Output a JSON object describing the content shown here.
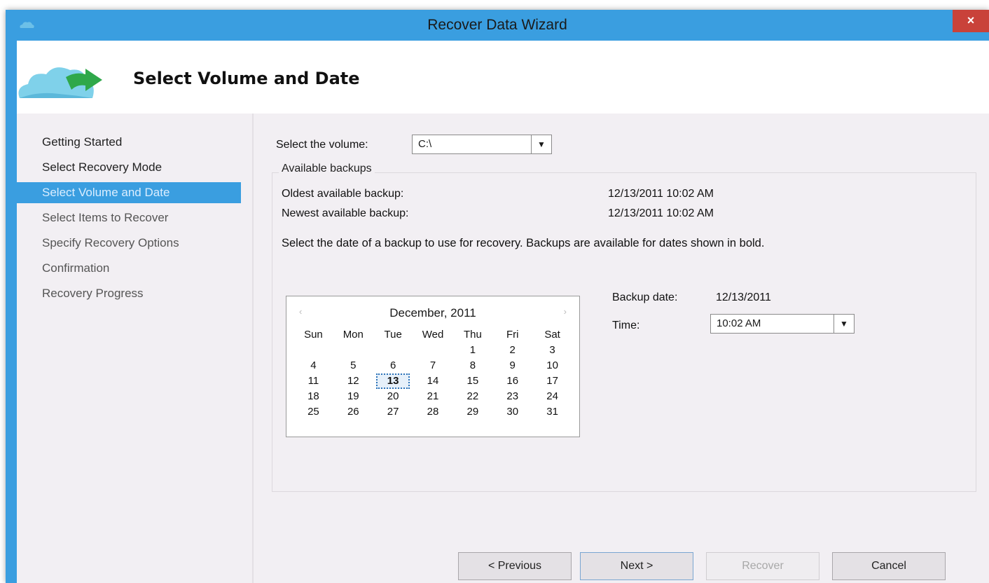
{
  "window": {
    "title": "Recover Data Wizard",
    "close_label": "×"
  },
  "header": {
    "title": "Select Volume and Date"
  },
  "nav": {
    "items": [
      {
        "label": "Getting Started"
      },
      {
        "label": "Select Recovery Mode"
      },
      {
        "label": "Select Volume and Date"
      },
      {
        "label": "Select Items to Recover"
      },
      {
        "label": "Specify Recovery Options"
      },
      {
        "label": "Confirmation"
      },
      {
        "label": "Recovery Progress"
      }
    ]
  },
  "volume": {
    "label": "Select the volume:",
    "value": "C:\\"
  },
  "backups": {
    "legend": "Available backups",
    "oldest_label": "Oldest available backup:",
    "oldest_value": "12/13/2011 10:02 AM",
    "newest_label": "Newest available backup:",
    "newest_value": "12/13/2011 10:02 AM",
    "instruction": "Select the date of a backup to use for recovery. Backups are available for dates shown in bold."
  },
  "calendar": {
    "month": "December, 2011",
    "prev": "‹",
    "next": "›",
    "days": [
      "Sun",
      "Mon",
      "Tue",
      "Wed",
      "Thu",
      "Fri",
      "Sat"
    ],
    "weeks": [
      [
        "",
        "",
        "",
        "",
        "1",
        "2",
        "3"
      ],
      [
        "4",
        "5",
        "6",
        "7",
        "8",
        "9",
        "10"
      ],
      [
        "11",
        "12",
        "13",
        "14",
        "15",
        "16",
        "17"
      ],
      [
        "18",
        "19",
        "20",
        "21",
        "22",
        "23",
        "24"
      ],
      [
        "25",
        "26",
        "27",
        "28",
        "29",
        "30",
        "31"
      ]
    ],
    "selected": "13"
  },
  "backup_date": {
    "label": "Backup date:",
    "value": "12/13/2011"
  },
  "time": {
    "label": "Time:",
    "value": "10:02 AM"
  },
  "buttons": {
    "previous": "< Previous",
    "next": "Next >",
    "recover": "Recover",
    "cancel": "Cancel"
  },
  "colors": {
    "accent": "#3a9ee0",
    "close": "#c9423a",
    "background": "#f2eff3"
  }
}
